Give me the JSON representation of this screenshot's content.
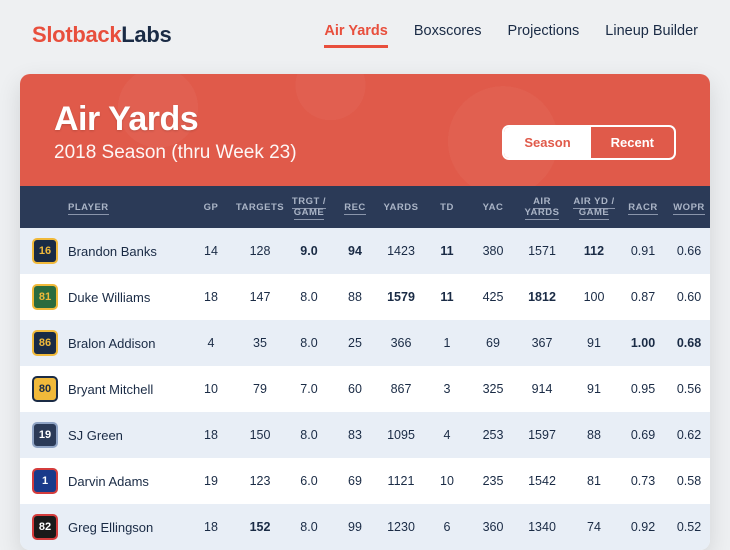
{
  "brand": {
    "a": "Slotback",
    "b": "Labs"
  },
  "nav": [
    {
      "label": "Air Yards",
      "active": true
    },
    {
      "label": "Boxscores",
      "active": false
    },
    {
      "label": "Projections",
      "active": false
    },
    {
      "label": "Lineup Builder",
      "active": false
    }
  ],
  "header": {
    "title": "Air Yards",
    "subtitle": "2018 Season (thru Week 23)",
    "toggle": {
      "season": "Season",
      "recent": "Recent",
      "active": "season"
    }
  },
  "columns": {
    "player": "PLAYER",
    "gp": "GP",
    "targets": "TARGETS",
    "trgt_game": "TRGT / GAME",
    "rec": "REC",
    "yards": "YARDS",
    "td": "TD",
    "yac": "YAC",
    "air_yards": "AIR YARDS",
    "air_yd_game": "AIR YD / GAME",
    "racr": "RACR",
    "wopr": "WOPR"
  },
  "rows": [
    {
      "num": "16",
      "jersey_bg": "#1a2b45",
      "jersey_fg": "#f0b93a",
      "jersey_border": "#f0b93a",
      "name": "Brandon Banks",
      "gp": "14",
      "targets": "128",
      "trgt_game": "9.0",
      "rec": "94",
      "yards": "1423",
      "td": "11",
      "yac": "380",
      "air_yards": "1571",
      "air_yd_game": "112",
      "racr": "0.91",
      "wopr": "0.66",
      "bold": {
        "trgt_game": true,
        "rec": true,
        "td": true,
        "air_yd_game": true
      }
    },
    {
      "num": "81",
      "jersey_bg": "#2a6b3e",
      "jersey_fg": "#f0b93a",
      "jersey_border": "#f0b93a",
      "name": "Duke Williams",
      "gp": "18",
      "targets": "147",
      "trgt_game": "8.0",
      "rec": "88",
      "yards": "1579",
      "td": "11",
      "yac": "425",
      "air_yards": "1812",
      "air_yd_game": "100",
      "racr": "0.87",
      "wopr": "0.60",
      "bold": {
        "yards": true,
        "td": true,
        "air_yards": true
      }
    },
    {
      "num": "86",
      "jersey_bg": "#1a2b45",
      "jersey_fg": "#f0b93a",
      "jersey_border": "#f0b93a",
      "name": "Bralon Addison",
      "gp": "4",
      "targets": "35",
      "trgt_game": "8.0",
      "rec": "25",
      "yards": "366",
      "td": "1",
      "yac": "69",
      "air_yards": "367",
      "air_yd_game": "91",
      "racr": "1.00",
      "wopr": "0.68",
      "bold": {
        "racr": true,
        "wopr": true
      }
    },
    {
      "num": "80",
      "jersey_bg": "#f0b93a",
      "jersey_fg": "#1a2b45",
      "jersey_border": "#1a2b45",
      "name": "Bryant Mitchell",
      "gp": "10",
      "targets": "79",
      "trgt_game": "7.0",
      "rec": "60",
      "yards": "867",
      "td": "3",
      "yac": "325",
      "air_yards": "914",
      "air_yd_game": "91",
      "racr": "0.95",
      "wopr": "0.56",
      "bold": {}
    },
    {
      "num": "19",
      "jersey_bg": "#2b3a57",
      "jersey_fg": "#ffffff",
      "jersey_border": "#8fa3c4",
      "name": "SJ Green",
      "gp": "18",
      "targets": "150",
      "trgt_game": "8.0",
      "rec": "83",
      "yards": "1095",
      "td": "4",
      "yac": "253",
      "air_yards": "1597",
      "air_yd_game": "88",
      "racr": "0.69",
      "wopr": "0.62",
      "bold": {}
    },
    {
      "num": "1",
      "jersey_bg": "#1a3a8a",
      "jersey_fg": "#ffffff",
      "jersey_border": "#d43c3c",
      "name": "Darvin Adams",
      "gp": "19",
      "targets": "123",
      "trgt_game": "6.0",
      "rec": "69",
      "yards": "1121",
      "td": "10",
      "yac": "235",
      "air_yards": "1542",
      "air_yd_game": "81",
      "racr": "0.73",
      "wopr": "0.58",
      "bold": {}
    },
    {
      "num": "82",
      "jersey_bg": "#1a1a1a",
      "jersey_fg": "#ffffff",
      "jersey_border": "#d43c3c",
      "name": "Greg Ellingson",
      "gp": "18",
      "targets": "152",
      "trgt_game": "8.0",
      "rec": "99",
      "yards": "1230",
      "td": "6",
      "yac": "360",
      "air_yards": "1340",
      "air_yd_game": "74",
      "racr": "0.92",
      "wopr": "0.52",
      "bold": {
        "targets": true
      }
    }
  ]
}
